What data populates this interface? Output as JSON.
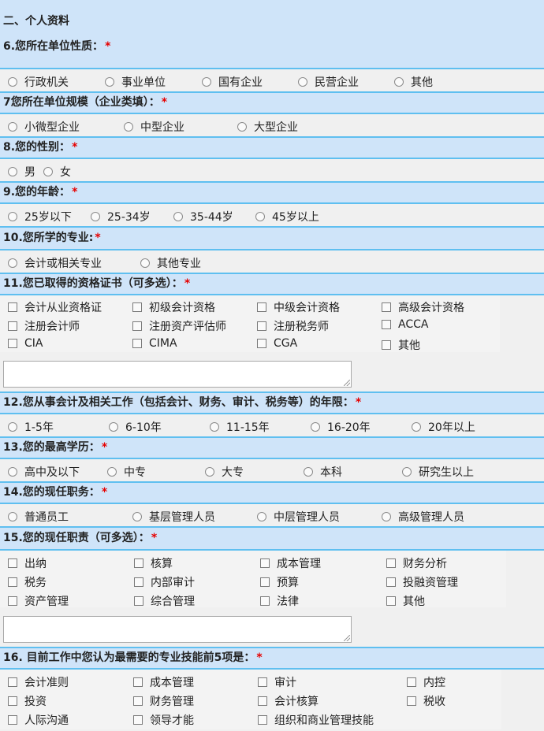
{
  "section": "二、个人资料",
  "questions": [
    {
      "label": "6.您所在单位性质：",
      "required": "*",
      "options": [
        "行政机关",
        "事业单位",
        "国有企业",
        "民营企业",
        "其他"
      ]
    },
    {
      "label": "7您所在单位规模（企业类填）：",
      "required": "*",
      "options": [
        "小微型企业",
        "中型企业",
        "大型企业"
      ]
    },
    {
      "label": "8.您的性别：",
      "required": "*",
      "options": [
        "男",
        "女"
      ]
    },
    {
      "label": "9.您的年龄：",
      "required": "*",
      "options": [
        "25岁以下",
        "25-34岁",
        "35-44岁",
        "45岁以上"
      ]
    },
    {
      "label": "10.您所学的专业:",
      "required": "*",
      "options": [
        "会计或相关专业",
        "其他专业"
      ]
    },
    {
      "label": "11.您已取得的资格证书（可多选）：",
      "required": "*",
      "options": [
        "会计从业资格证",
        "初级会计资格",
        "中级会计资格",
        "高级会计资格",
        "注册会计师",
        "注册资产评估师",
        "注册税务师",
        "ACCA",
        "CIA",
        "CIMA",
        "CGA",
        "其他"
      ]
    },
    {
      "label": "12.您从事会计及相关工作（包括会计、财务、审计、税务等）的年限：",
      "required": "*",
      "options": [
        "1-5年",
        "6-10年",
        "11-15年",
        "16-20年",
        "20年以上"
      ]
    },
    {
      "label": "13.您的最高学历：",
      "required": "*",
      "options": [
        "高中及以下",
        "中专",
        "大专",
        "本科",
        "研究生以上"
      ]
    },
    {
      "label": "14.您的现任职务：",
      "required": "*",
      "options": [
        "普通员工",
        "基层管理人员",
        "中层管理人员",
        "高级管理人员"
      ]
    },
    {
      "label": "15.您的现任职责（可多选）：",
      "required": "*",
      "options": [
        "出纳",
        "核算",
        "成本管理",
        "财务分析",
        "税务",
        "内部审计",
        "预算",
        "投融资管理",
        "资产管理",
        "综合管理",
        "法律",
        "其他"
      ]
    },
    {
      "label": "16. 目前工作中您认为最需要的专业技能前5项是：",
      "required": "*",
      "options": [
        "会计准则",
        "成本管理",
        "审计",
        "内控",
        "投资",
        "财务管理",
        "会计核算",
        "税收",
        "人际沟通",
        "领导才能",
        "组织和商业管理技能"
      ]
    }
  ],
  "other_text": {
    "q11": "",
    "q15": ""
  }
}
